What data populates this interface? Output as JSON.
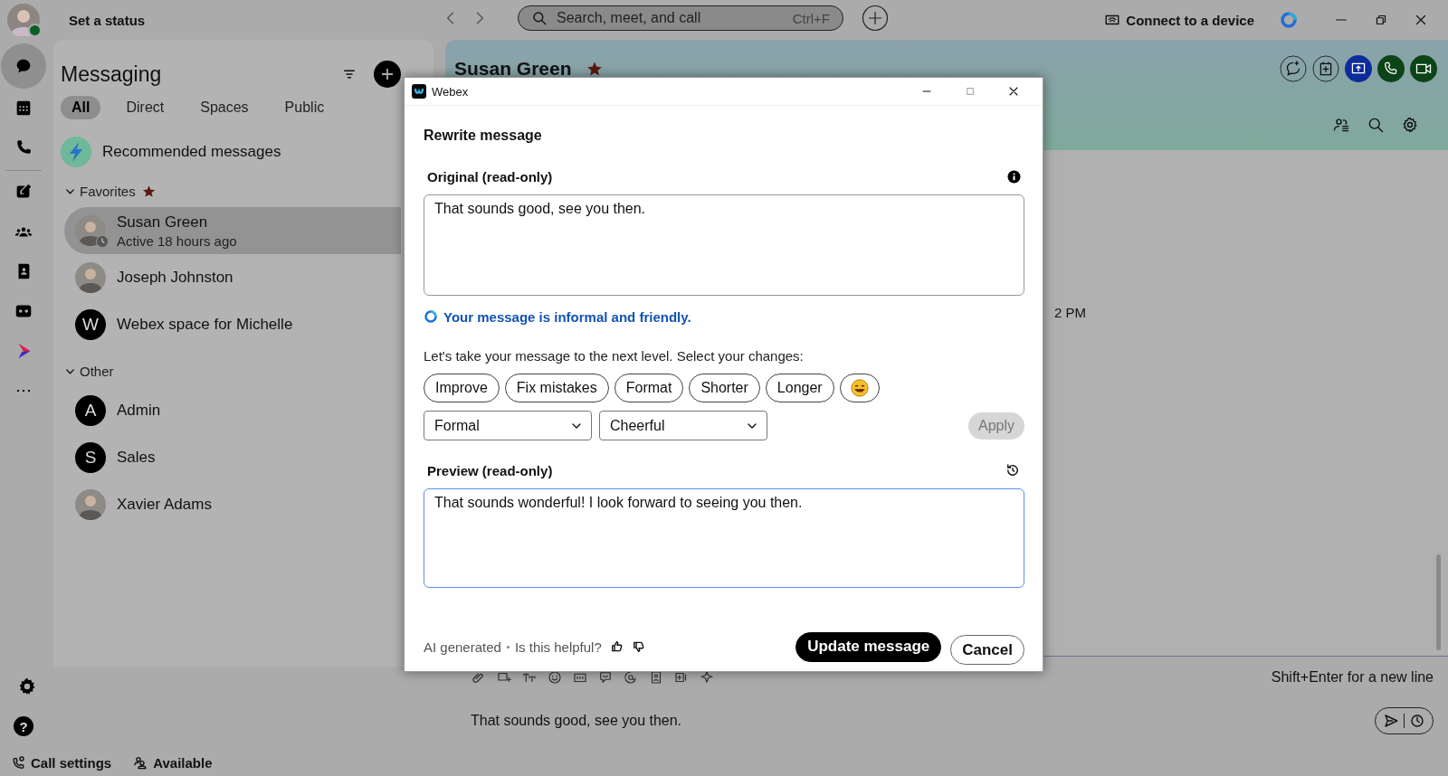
{
  "topbar": {
    "status": "Set a status",
    "online": true,
    "search": {
      "placeholder": "Search, meet, and call",
      "shortcut": "Ctrl+F"
    },
    "connect": "Connect to a device"
  },
  "rail": {
    "items": [
      {
        "kind": "chat",
        "selected": true
      },
      {
        "kind": "calendar",
        "selected": false
      },
      {
        "kind": "phone",
        "selected": false
      },
      {
        "kind": "compose",
        "selected": false
      },
      {
        "kind": "team",
        "selected": false
      },
      {
        "kind": "contacts",
        "selected": false
      },
      {
        "kind": "voicemail",
        "selected": false
      },
      {
        "kind": "play",
        "selected": false
      },
      {
        "kind": "more",
        "selected": false
      }
    ],
    "help_glyph": "?"
  },
  "messaging": {
    "title": "Messaging",
    "filters": [
      {
        "label": "All",
        "selected": true
      },
      {
        "label": "Direct",
        "selected": false
      },
      {
        "label": "Spaces",
        "selected": false
      },
      {
        "label": "Public",
        "selected": false
      }
    ],
    "recommended": "Recommended messages",
    "sections": [
      {
        "label": "Favorites",
        "expanded": true,
        "starred": true,
        "items": [
          {
            "name": "Susan Green",
            "status": "Active 18 hours ago",
            "kind": "photo",
            "away": true,
            "selected": true
          },
          {
            "name": "Joseph Johnston",
            "kind": "photo",
            "away": false,
            "selected": false
          },
          {
            "name": "Webex space for Michelle",
            "kind": "letter",
            "initial": "W",
            "away": false,
            "selected": false
          }
        ]
      },
      {
        "label": "Other",
        "expanded": true,
        "starred": false,
        "items": [
          {
            "name": "Admin",
            "kind": "letter",
            "initial": "A",
            "away": false,
            "selected": false
          },
          {
            "name": "Sales",
            "kind": "letter",
            "initial": "S",
            "away": false,
            "selected": false
          },
          {
            "name": "Xavier Adams",
            "kind": "photo",
            "away": false,
            "selected": false
          }
        ]
      }
    ]
  },
  "chat": {
    "title": "Susan Green",
    "favorite": true,
    "timestamp": "2 PM",
    "composer": {
      "hint": "Shift+Enter for a new line",
      "value": "That sounds good, see you then."
    }
  },
  "footer": {
    "call_settings": "Call settings",
    "availability": "Available"
  },
  "dialog": {
    "app": "Webex",
    "title": "Rewrite message",
    "original": {
      "label": "Original (read-only)",
      "value": "That sounds good, see you then."
    },
    "tone_note": "Your message is informal and friendly.",
    "prompt": "Let's take your message to the next level. Select your changes:",
    "chips": [
      {
        "kind": "text",
        "label": "Improve"
      },
      {
        "kind": "text",
        "label": "Fix mistakes"
      },
      {
        "kind": "text",
        "label": "Format"
      },
      {
        "kind": "text",
        "label": "Shorter"
      },
      {
        "kind": "text",
        "label": "Longer"
      },
      {
        "kind": "emoji"
      }
    ],
    "selects": [
      {
        "value": "Formal"
      },
      {
        "value": "Cheerful"
      }
    ],
    "apply": {
      "label": "Apply",
      "disabled": true
    },
    "preview": {
      "label": "Preview (read-only)",
      "value": "That sounds wonderful! I look forward to seeing you then."
    },
    "ai_note": "AI generated",
    "feedback": "Is this helpful?",
    "buttons": [
      {
        "kind": "primary",
        "label": "Update message"
      },
      {
        "kind": "secondary",
        "label": "Cancel"
      }
    ]
  }
}
